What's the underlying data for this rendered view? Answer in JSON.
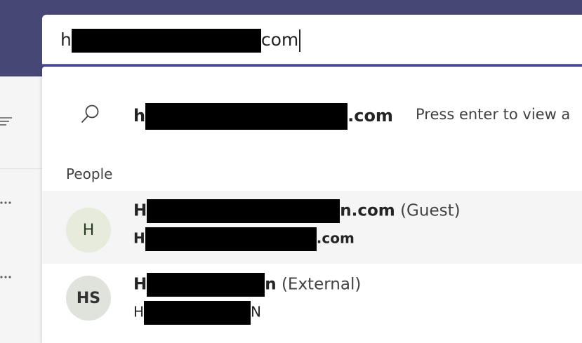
{
  "search": {
    "prefix": "h",
    "suffix": "com"
  },
  "suggestion": {
    "query_prefix": "h",
    "query_suffix": ".com",
    "hint": "Press enter to view a"
  },
  "people_section": {
    "label": "People"
  },
  "people": [
    {
      "initials": "H",
      "name_prefix": "H",
      "name_suffix": "n.com",
      "tag": "(Guest)",
      "sub_prefix": "H",
      "sub_suffix": ".com"
    },
    {
      "initials": "HS",
      "name_prefix": "H",
      "name_suffix": "n",
      "tag": "(External)",
      "sub_prefix": "H",
      "sub_suffix": "N"
    }
  ],
  "colors": {
    "topbar": "#464775",
    "accent": "#5b5fc7",
    "redaction": "#000000"
  },
  "icons": [
    "search-icon",
    "filter-icon",
    "more-options-icon"
  ]
}
